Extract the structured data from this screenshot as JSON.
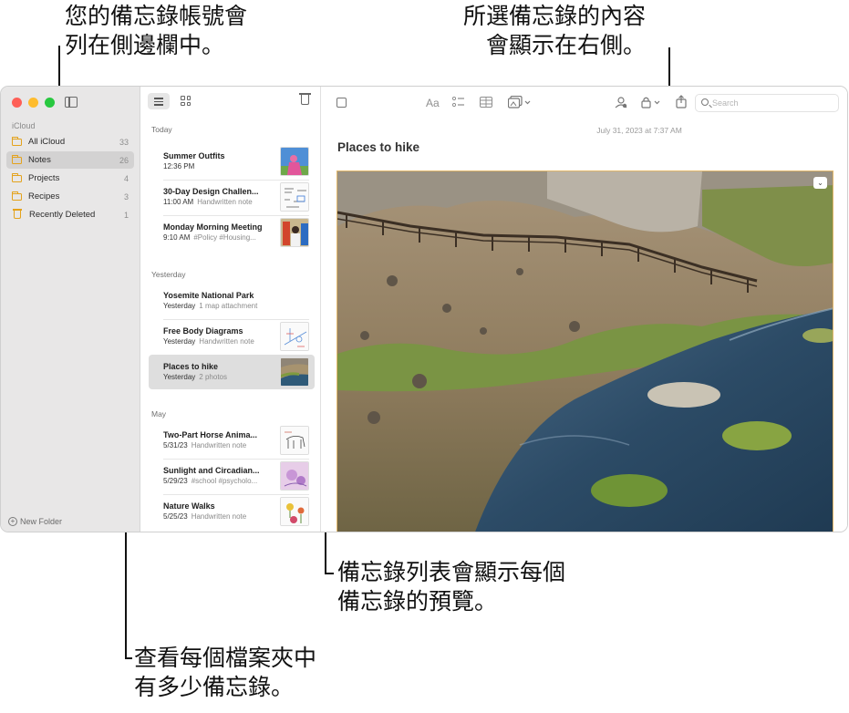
{
  "callouts": {
    "accounts": [
      "您的備忘錄帳號會",
      "列在側邊欄中。"
    ],
    "content": [
      "所選備忘錄的內容",
      "會顯示在右側。"
    ],
    "preview": [
      "備忘錄列表會顯示每個",
      "備忘錄的預覽。"
    ],
    "counts": [
      "查看每個檔案夾中",
      "有多少備忘錄。"
    ]
  },
  "sidebar": {
    "account": "iCloud",
    "folders": [
      {
        "name": "All iCloud",
        "count": "33"
      },
      {
        "name": "Notes",
        "count": "26"
      },
      {
        "name": "Projects",
        "count": "4"
      },
      {
        "name": "Recipes",
        "count": "3"
      },
      {
        "name": "Recently Deleted",
        "count": "1"
      }
    ],
    "new_folder": "New Folder"
  },
  "notelist": {
    "sections": [
      "Today",
      "Yesterday",
      "May"
    ],
    "notes": [
      {
        "title": "Summer Outfits",
        "time": "12:36 PM",
        "preview": ""
      },
      {
        "title": "30-Day Design Challen...",
        "time": "11:00 AM",
        "preview": "Handwritten note"
      },
      {
        "title": "Monday Morning Meeting",
        "time": "9:10 AM",
        "preview": "#Policy #Housing..."
      },
      {
        "title": "Yosemite National Park",
        "time": "Yesterday",
        "preview": "1 map attachment"
      },
      {
        "title": "Free Body Diagrams",
        "time": "Yesterday",
        "preview": "Handwritten note"
      },
      {
        "title": "Places to hike",
        "time": "Yesterday",
        "preview": "2 photos"
      },
      {
        "title": "Two-Part Horse Anima...",
        "time": "5/31/23",
        "preview": "Handwritten note"
      },
      {
        "title": "Sunlight and Circadian...",
        "time": "5/29/23",
        "preview": "#school #psycholo..."
      },
      {
        "title": "Nature Walks",
        "time": "5/25/23",
        "preview": "Handwritten note"
      }
    ]
  },
  "editor": {
    "format_label": "Aa",
    "search_placeholder": "Search",
    "date": "July 31, 2023 at 7:37 AM",
    "title": "Places to hike",
    "photo_menu_icon": "⌄"
  },
  "colors": {
    "accent": "#e4a21b",
    "sidebar_bg": "#e8e7e7",
    "selected_row": "#dedede"
  }
}
